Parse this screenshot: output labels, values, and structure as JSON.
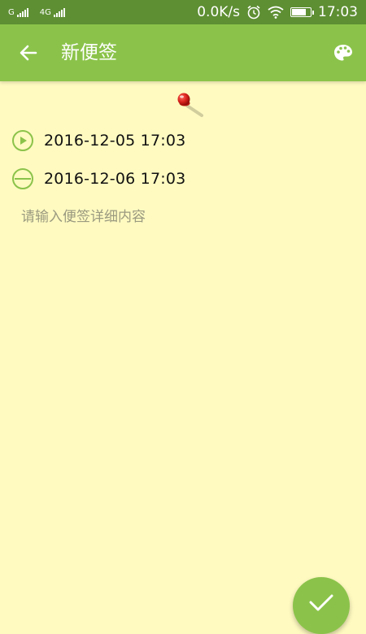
{
  "status_bar": {
    "sim1": "G",
    "sim2": "4G",
    "network_speed": "0.0K/s",
    "time": "17:03"
  },
  "app_bar": {
    "title": "新便签"
  },
  "reminders": [
    {
      "label": "2016-12-05 17:03",
      "icon": "play-circle-icon"
    },
    {
      "label": "2016-12-06 17:03",
      "icon": "minus-circle-icon"
    }
  ],
  "note": {
    "placeholder": "请输入便签详细内容",
    "value": ""
  },
  "colors": {
    "status_bar": "#5e8f33",
    "app_bar": "#8bc34a",
    "background": "#fffac0",
    "accent": "#8bc34a"
  }
}
